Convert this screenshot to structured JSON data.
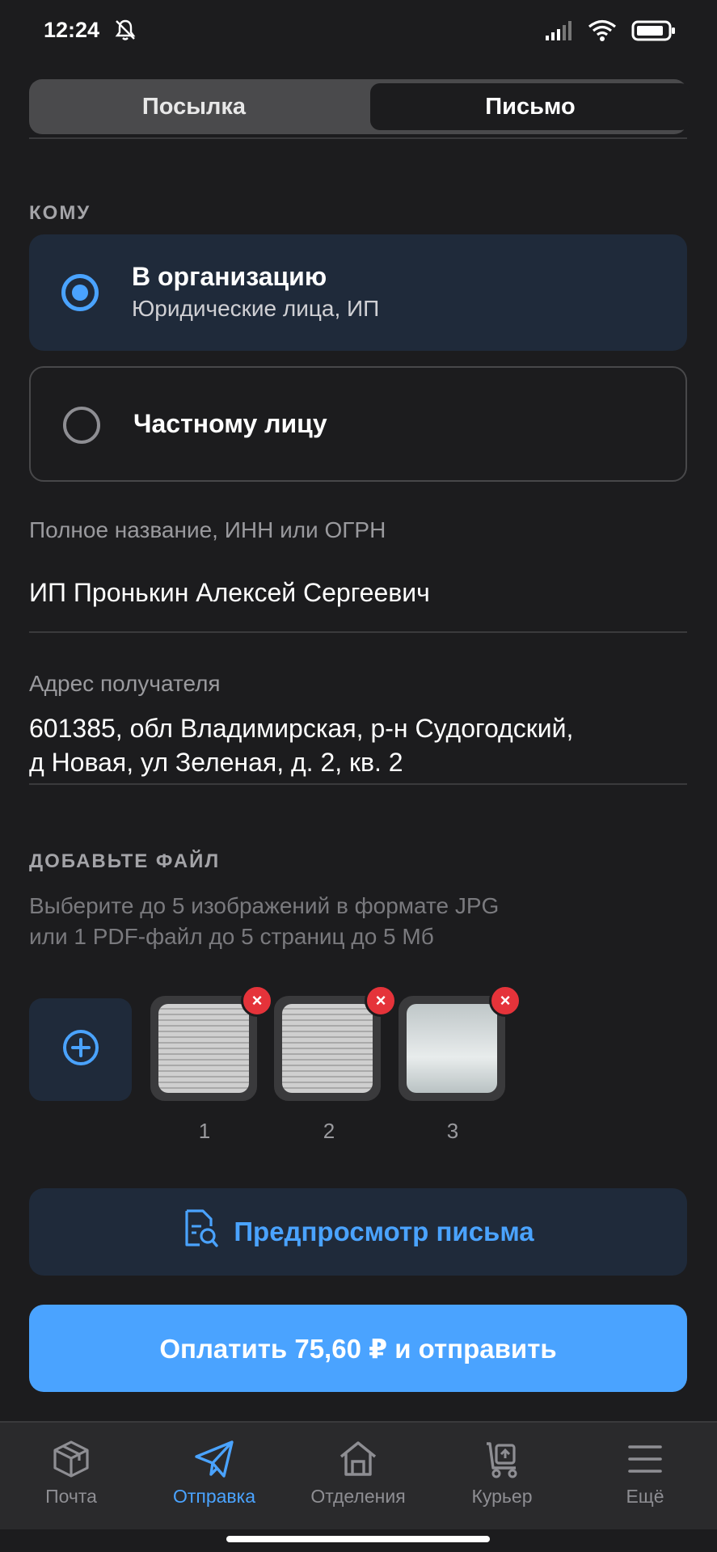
{
  "status_bar": {
    "time": "12:24"
  },
  "segmented": {
    "left_label": "Посылка",
    "right_label": "Письмо",
    "selected": "Письмо"
  },
  "recipient": {
    "section_label": "КОМУ",
    "option_org_title": "В организацию",
    "option_org_subtitle": "Юридические лица, ИП",
    "option_private_title": "Частному лицу",
    "selected": "В организацию"
  },
  "fields": {
    "name_label": "Полное название, ИНН или ОГРН",
    "name_value": "ИП Пронькин Алексей Сергеевич",
    "address_label": "Адрес получателя",
    "address_line1": "601385, обл Владимирская, р-н Судогодский,",
    "address_line2": "д Новая, ул Зеленая, д. 2, кв. 2"
  },
  "files": {
    "section_label": "ДОБАВЬТЕ ФАЙЛ",
    "hint_line1": "Выберите до 5 изображений в формате JPG",
    "hint_line2": "или 1 PDF-файл до 5 страниц до 5 Мб",
    "items": [
      {
        "number": "1"
      },
      {
        "number": "2"
      },
      {
        "number": "3"
      }
    ]
  },
  "actions": {
    "preview_label": "Предпросмотр письма",
    "pay_label": "Оплатить 75,60 ₽ и отправить"
  },
  "tabbar": {
    "items": [
      {
        "label": "Почта",
        "icon": "package-icon"
      },
      {
        "label": "Отправка",
        "icon": "send-icon",
        "active": true
      },
      {
        "label": "Отделения",
        "icon": "house-icon"
      },
      {
        "label": "Курьер",
        "icon": "courier-cart-icon"
      },
      {
        "label": "Ещё",
        "icon": "menu-icon"
      }
    ]
  },
  "colors": {
    "accent": "#4aa3ff",
    "background": "#1c1c1e",
    "danger": "#e5333a"
  }
}
